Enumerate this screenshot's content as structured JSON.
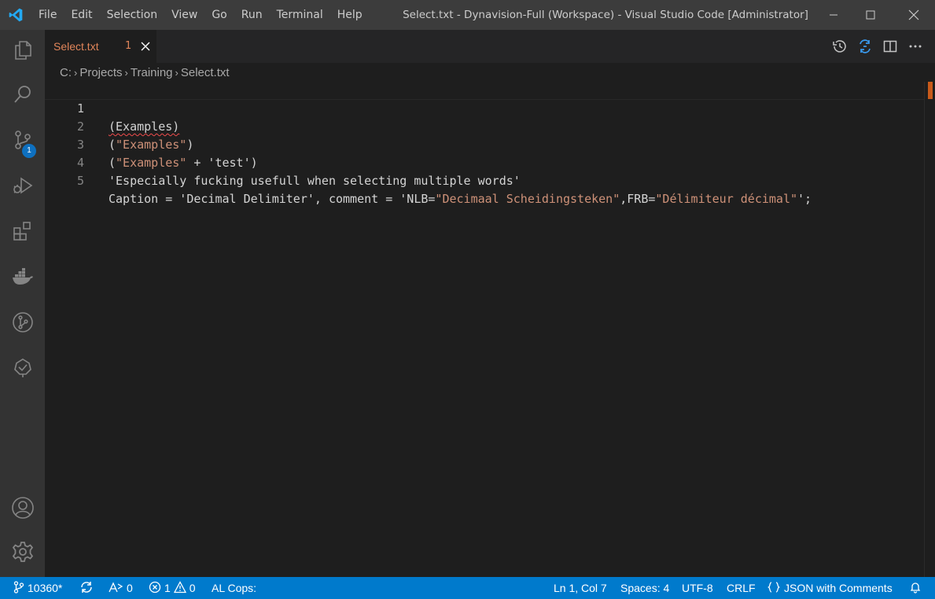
{
  "menu": [
    "File",
    "Edit",
    "Selection",
    "View",
    "Go",
    "Run",
    "Terminal",
    "Help"
  ],
  "window_title": "Select.txt - Dynavision-Full (Workspace) - Visual Studio Code [Administrator]",
  "activity": {
    "scm_badge": "1"
  },
  "tab": {
    "label": "Select.txt",
    "problem_count": "1"
  },
  "breadcrumb": {
    "drive": "C:",
    "folder1": "Projects",
    "folder2": "Training",
    "file": "Select.txt"
  },
  "editor": {
    "lines": [
      {
        "number": "1",
        "parts": {
          "p1": "(Examples)"
        }
      },
      {
        "number": "2",
        "parts": {
          "open": "(",
          "str": "\"Examples\"",
          "close": ")"
        }
      },
      {
        "number": "3",
        "parts": {
          "open": "(",
          "str": "\"Examples\"",
          "rest": " + 'test')"
        }
      },
      {
        "number": "4",
        "parts": {
          "p1": "'Especially fucking usefull when selecting multiple words'"
        }
      },
      {
        "number": "5",
        "parts": {
          "a": "Caption = 'Decimal Delimiter', comment = 'NLB=",
          "s1": "\"Decimaal Scheidingsteken\"",
          "b": ",FRB=",
          "s2": "\"Délimiteur décimal\"",
          "c": "';"
        }
      }
    ]
  },
  "status": {
    "branch": "10360*",
    "ports": "0",
    "errors": "1",
    "warnings": "0",
    "al_cops": "AL Cops:",
    "position": "Ln 1, Col 7",
    "spaces": "Spaces: 4",
    "encoding": "UTF-8",
    "eol": "CRLF",
    "language": "JSON with Comments"
  },
  "colors": {
    "accent": "#007acc",
    "tab_label": "#e0855a",
    "string": "#ce9178"
  }
}
